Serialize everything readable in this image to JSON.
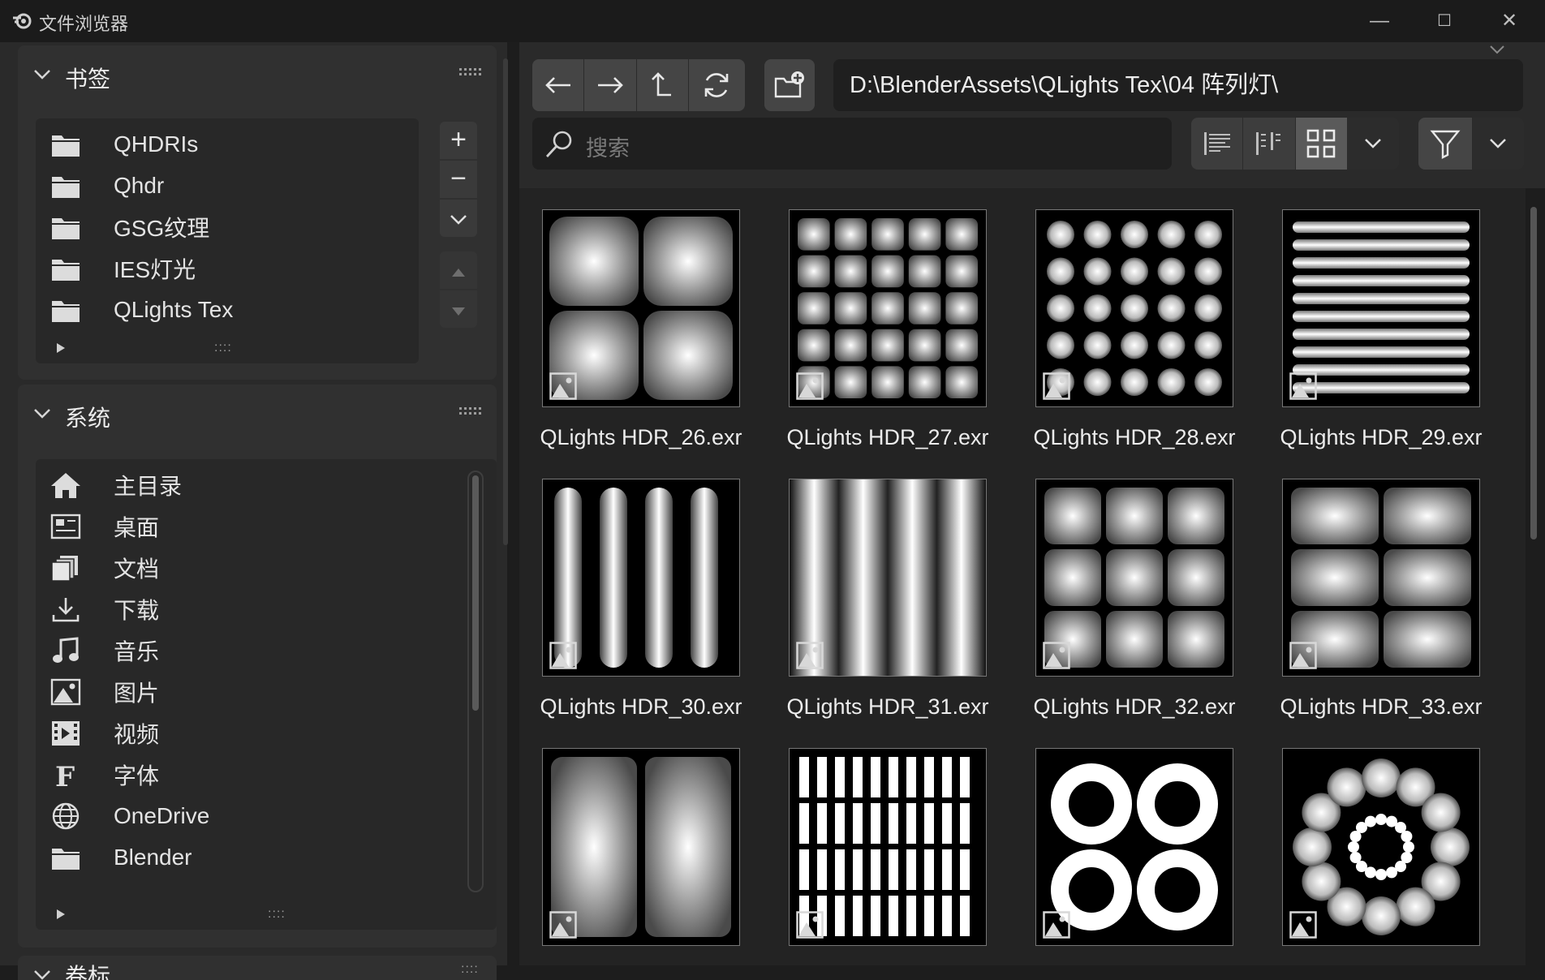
{
  "window": {
    "title": "文件浏览器",
    "minimize": "—",
    "maximize": "☐",
    "close": "✕"
  },
  "bookmarks": {
    "title": "书签",
    "items": [
      {
        "label": "QHDRIs",
        "icon": "folder-icon"
      },
      {
        "label": "Qhdr",
        "icon": "folder-icon"
      },
      {
        "label": "GSG纹理",
        "icon": "folder-icon"
      },
      {
        "label": "IES灯光",
        "icon": "folder-icon"
      },
      {
        "label": "QLights Tex",
        "icon": "folder-icon"
      }
    ],
    "add": "+",
    "remove": "−"
  },
  "system": {
    "title": "系统",
    "items": [
      {
        "label": "主目录",
        "icon": "home-icon"
      },
      {
        "label": "桌面",
        "icon": "desktop-icon"
      },
      {
        "label": "文档",
        "icon": "documents-icon"
      },
      {
        "label": "下载",
        "icon": "download-icon"
      },
      {
        "label": "音乐",
        "icon": "music-icon"
      },
      {
        "label": "图片",
        "icon": "image-icon"
      },
      {
        "label": "视频",
        "icon": "video-icon"
      },
      {
        "label": "字体",
        "icon": "font-icon"
      },
      {
        "label": "OneDrive",
        "icon": "globe-icon"
      },
      {
        "label": "Blender",
        "icon": "folder-icon"
      }
    ]
  },
  "volumes": {
    "title": "卷标"
  },
  "toolbar": {
    "path": "D:\\BlenderAssets\\QLights Tex\\04 阵列灯\\",
    "search_placeholder": "搜索"
  },
  "files": [
    {
      "name": "QLights HDR_26.exr",
      "pattern": "soft2x2"
    },
    {
      "name": "QLights HDR_27.exr",
      "pattern": "square5x5"
    },
    {
      "name": "QLights HDR_28.exr",
      "pattern": "dots5x5"
    },
    {
      "name": "QLights HDR_29.exr",
      "pattern": "hstripes"
    },
    {
      "name": "QLights HDR_30.exr",
      "pattern": "vcapsules"
    },
    {
      "name": "QLights HDR_31.exr",
      "pattern": "vgradient"
    },
    {
      "name": "QLights HDR_32.exr",
      "pattern": "square3x3"
    },
    {
      "name": "QLights HDR_33.exr",
      "pattern": "rect2x3"
    },
    {
      "name": "",
      "pattern": "soft2x1"
    },
    {
      "name": "",
      "pattern": "bars"
    },
    {
      "name": "",
      "pattern": "rings"
    },
    {
      "name": "",
      "pattern": "radial"
    }
  ],
  "colors": {
    "accent": "#5a5a5a",
    "background": "#1d1d1d",
    "panel": "#303030"
  }
}
